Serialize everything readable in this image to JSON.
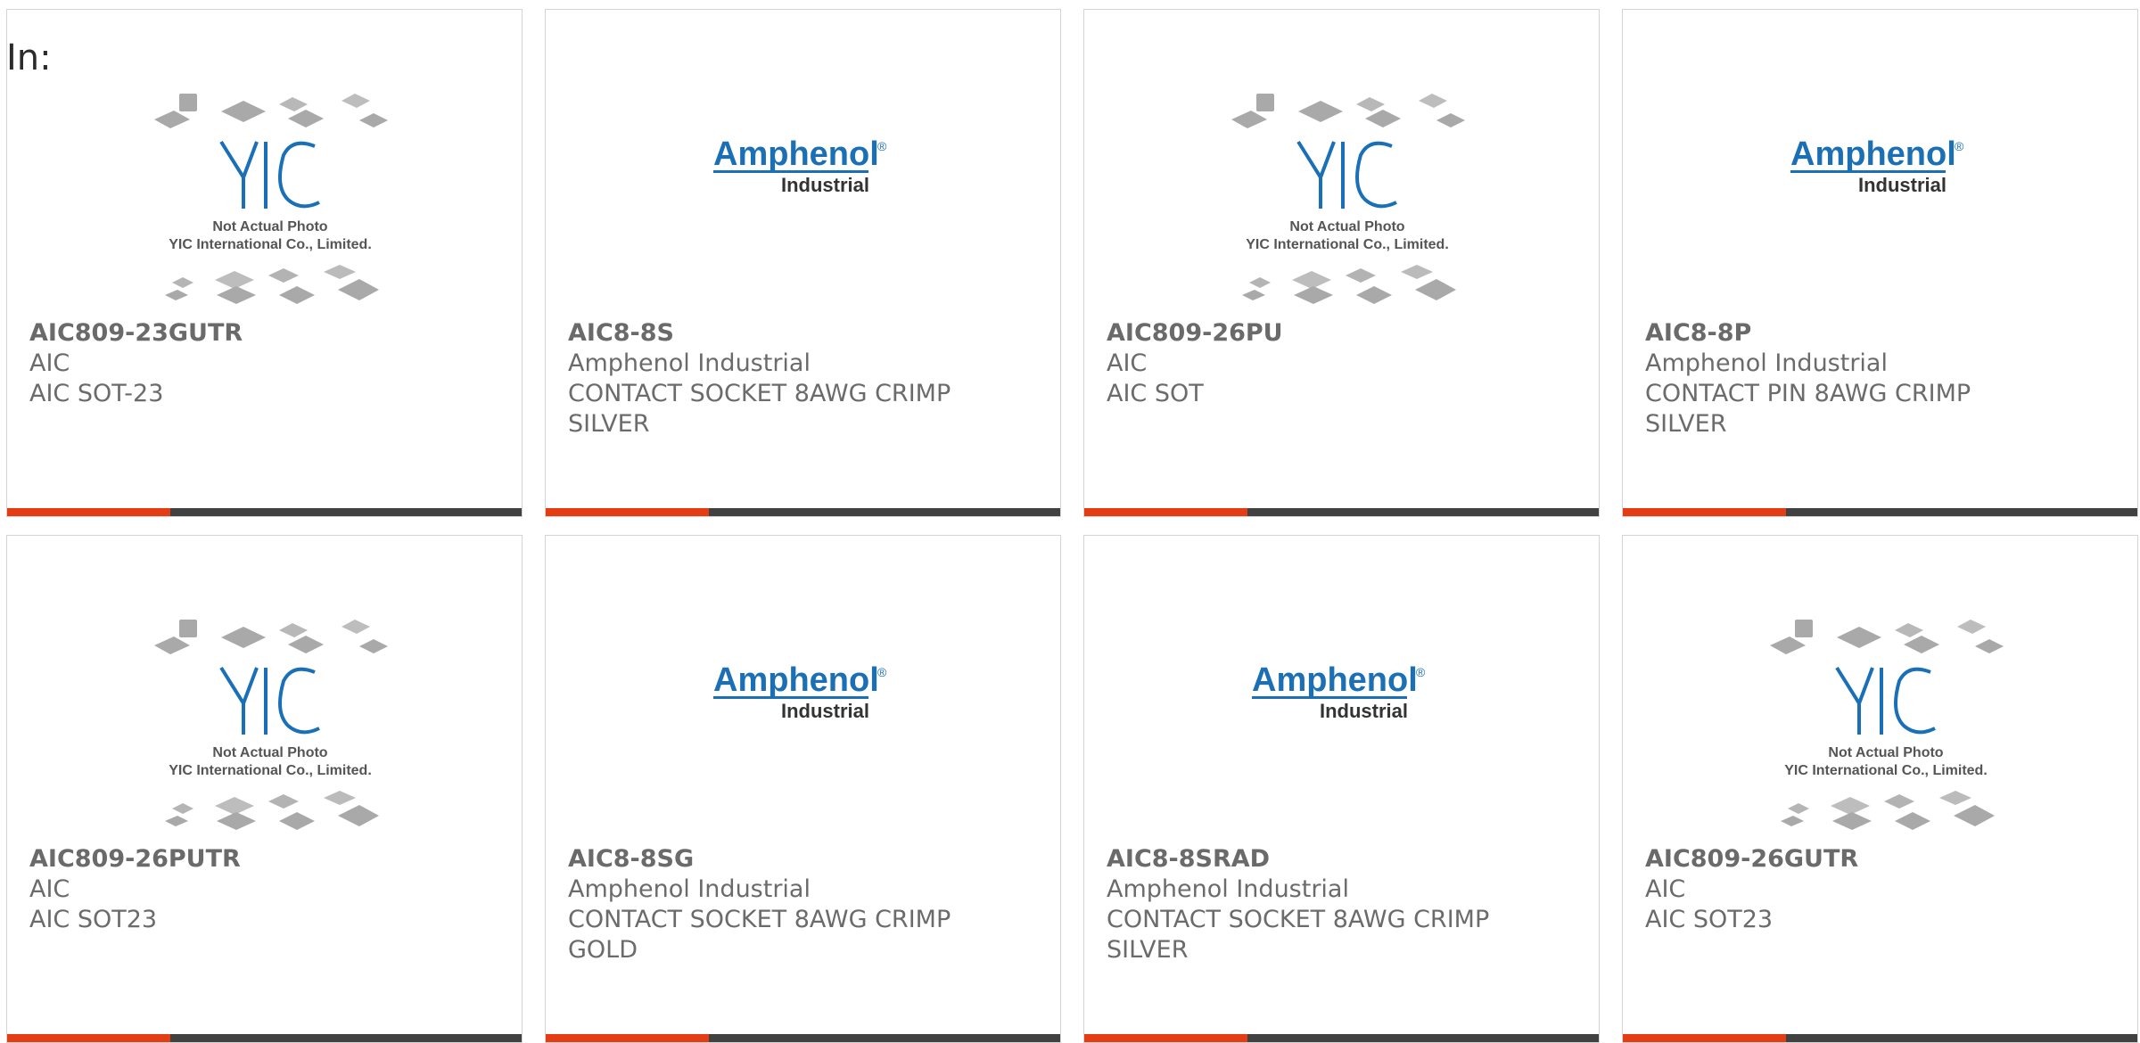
{
  "header": {
    "in_label": "In:"
  },
  "logos": {
    "yic": {
      "mark": "YIC",
      "line1": "Not Actual Photo",
      "line2": "YIC International Co., Limited."
    },
    "amphenol": {
      "mark": "Amphenol",
      "reg": "®",
      "sub": "Industrial"
    }
  },
  "colors": {
    "accent": "#e43d14",
    "bar": "#414141",
    "text": "#6b6b6b",
    "amphenol_blue": "#1b6fb5",
    "yic_blue": "#1a70b8"
  },
  "products": [
    {
      "image": "yic",
      "part_number": "AIC809-23GUTR",
      "manufacturer": "AIC",
      "desc_line1": "AIC SOT-23",
      "desc_line2": ""
    },
    {
      "image": "amphenol",
      "part_number": "AIC8-8S",
      "manufacturer": "Amphenol Industrial",
      "desc_line1": "CONTACT SOCKET 8AWG CRIMP",
      "desc_line2": "SILVER"
    },
    {
      "image": "yic",
      "part_number": "AIC809-26PU",
      "manufacturer": "AIC",
      "desc_line1": "AIC SOT",
      "desc_line2": ""
    },
    {
      "image": "amphenol",
      "part_number": "AIC8-8P",
      "manufacturer": "Amphenol Industrial",
      "desc_line1": "CONTACT PIN 8AWG CRIMP",
      "desc_line2": "SILVER"
    },
    {
      "image": "yic",
      "part_number": "AIC809-26PUTR",
      "manufacturer": "AIC",
      "desc_line1": "AIC SOT23",
      "desc_line2": ""
    },
    {
      "image": "amphenol",
      "part_number": "AIC8-8SG",
      "manufacturer": "Amphenol Industrial",
      "desc_line1": "CONTACT SOCKET 8AWG CRIMP",
      "desc_line2": "GOLD"
    },
    {
      "image": "amphenol",
      "part_number": "AIC8-8SRAD",
      "manufacturer": "Amphenol Industrial",
      "desc_line1": "CONTACT SOCKET 8AWG CRIMP",
      "desc_line2": "SILVER"
    },
    {
      "image": "yic",
      "part_number": "AIC809-26GUTR",
      "manufacturer": "AIC",
      "desc_line1": "AIC SOT23",
      "desc_line2": ""
    }
  ]
}
